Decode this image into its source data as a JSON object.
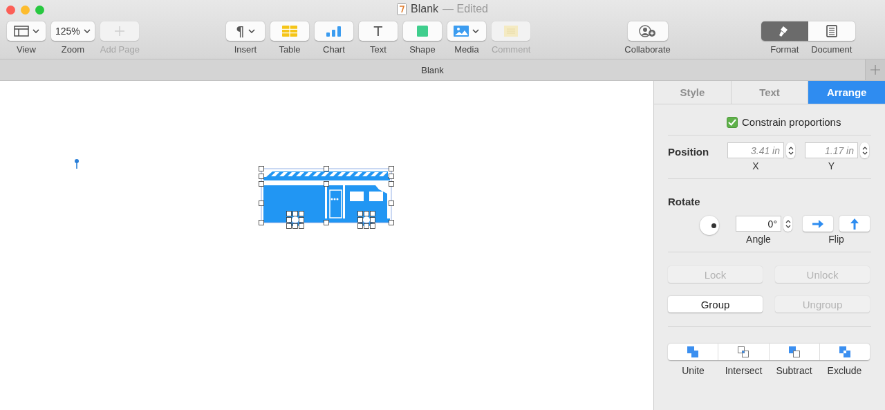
{
  "window": {
    "title": "Blank",
    "status": "— Edited"
  },
  "toolbar": {
    "left": [
      {
        "label": "View",
        "kind": "sidebar",
        "dropdown": true,
        "disabled": false
      },
      {
        "label": "Zoom",
        "value": "125%",
        "kind": "zoom",
        "dropdown": true,
        "disabled": false
      },
      {
        "label": "Add Page",
        "kind": "plus",
        "dropdown": false,
        "disabled": true
      }
    ],
    "center": [
      {
        "label": "Insert",
        "glyph": "¶",
        "kind": "glyph",
        "dropdown": true,
        "disabled": false
      },
      {
        "label": "Table",
        "kind": "table",
        "dropdown": false,
        "disabled": false
      },
      {
        "label": "Chart",
        "kind": "chart",
        "dropdown": false,
        "disabled": false
      },
      {
        "label": "Text",
        "glyph": "T",
        "kind": "glyph",
        "dropdown": false,
        "disabled": false
      },
      {
        "label": "Shape",
        "kind": "shape",
        "dropdown": false,
        "disabled": false
      },
      {
        "label": "Media",
        "kind": "media",
        "dropdown": true,
        "disabled": false
      },
      {
        "label": "Comment",
        "kind": "comment",
        "dropdown": false,
        "disabled": true
      }
    ],
    "collaborate": {
      "label": "Collaborate"
    },
    "inspector_switch": [
      {
        "label": "Format",
        "kind": "brush",
        "selected": true
      },
      {
        "label": "Document",
        "kind": "document",
        "selected": false
      }
    ]
  },
  "tab_bar": {
    "title": "Blank"
  },
  "canvas": {
    "shape_selected": true
  },
  "inspector": {
    "tabs": [
      {
        "label": "Style",
        "selected": false
      },
      {
        "label": "Text",
        "selected": false
      },
      {
        "label": "Arrange",
        "selected": true
      }
    ],
    "constrain": {
      "label": "Constrain proportions",
      "checked": true
    },
    "position": {
      "label": "Position",
      "x": {
        "value": "3.41 in",
        "caption": "X"
      },
      "y": {
        "value": "1.17 in",
        "caption": "Y"
      }
    },
    "rotate": {
      "label": "Rotate",
      "angle": "0°",
      "angle_caption": "Angle",
      "flip_caption": "Flip"
    },
    "lock_buttons": [
      {
        "label": "Lock",
        "disabled": true
      },
      {
        "label": "Unlock",
        "disabled": true
      },
      {
        "label": "Group",
        "disabled": false
      },
      {
        "label": "Ungroup",
        "disabled": true
      }
    ],
    "shape_ops": [
      {
        "label": "Unite",
        "kind": "unite"
      },
      {
        "label": "Intersect",
        "kind": "intersect"
      },
      {
        "label": "Subtract",
        "kind": "subtract"
      },
      {
        "label": "Exclude",
        "kind": "exclude"
      }
    ]
  }
}
